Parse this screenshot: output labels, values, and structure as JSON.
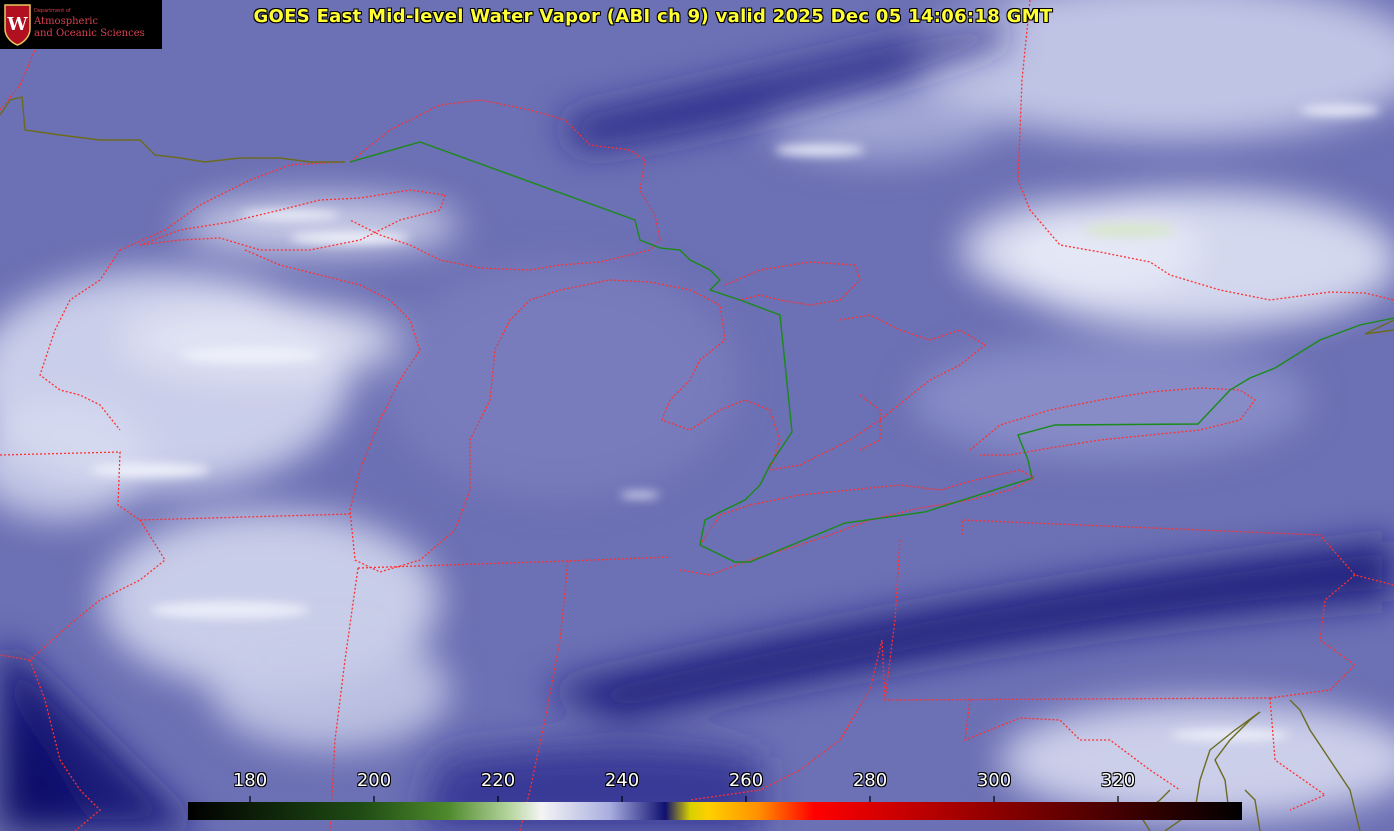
{
  "header": {
    "title": "GOES East Mid-level Water Vapor (ABI ch 9)  valid 2025 Dec 05 14:06:18 GMT"
  },
  "logo": {
    "crest_letter": "W",
    "dept_text": "Department of",
    "name_line1": "Atmospheric",
    "name_line2": "and Oceanic Sciences"
  },
  "colorbar": {
    "tick_labels": [
      "180",
      "200",
      "220",
      "240",
      "260",
      "280",
      "300",
      "320"
    ],
    "range": [
      170,
      340
    ],
    "stops": [
      {
        "v": 170,
        "c": "#000000"
      },
      {
        "v": 198,
        "c": "#1f4c14"
      },
      {
        "v": 212,
        "c": "#4f8a2c"
      },
      {
        "v": 222,
        "c": "#b7d6a0"
      },
      {
        "v": 227,
        "c": "#f4f4f4"
      },
      {
        "v": 238,
        "c": "#a9aee0"
      },
      {
        "v": 247,
        "c": "#101070"
      },
      {
        "v": 251,
        "c": "#d8d000"
      },
      {
        "v": 254,
        "c": "#ffd000"
      },
      {
        "v": 262,
        "c": "#ff9000"
      },
      {
        "v": 271,
        "c": "#ff0000"
      },
      {
        "v": 300,
        "c": "#8e0000"
      },
      {
        "v": 318,
        "c": "#4a0000"
      },
      {
        "v": 340,
        "c": "#000000"
      }
    ]
  },
  "colors": {
    "title_text": "#ffff33",
    "label_text": "#ffffff",
    "state_borders": "#ff3030",
    "intl_border": "#1a8a1a",
    "coastline": "#6b6b20",
    "imagery_dark": "#14167a",
    "imagery_mid": "#6c70b4",
    "imagery_light": "#e6e9f6"
  }
}
